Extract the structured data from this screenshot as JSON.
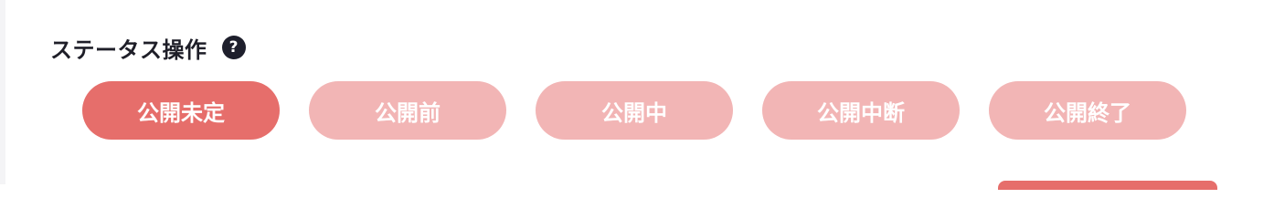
{
  "header": {
    "title": "ステータス操作",
    "help_icon": "question-circle-icon"
  },
  "statuses": [
    {
      "label": "公開未定",
      "active": true
    },
    {
      "label": "公開前",
      "active": false
    },
    {
      "label": "公開中",
      "active": false
    },
    {
      "label": "公開中断",
      "active": false
    },
    {
      "label": "公開終了",
      "active": false
    }
  ],
  "colors": {
    "active": "#e66e6b",
    "inactive": "#f2b5b5",
    "title": "#1e1e28",
    "icon_bg": "#1e1f2c"
  }
}
